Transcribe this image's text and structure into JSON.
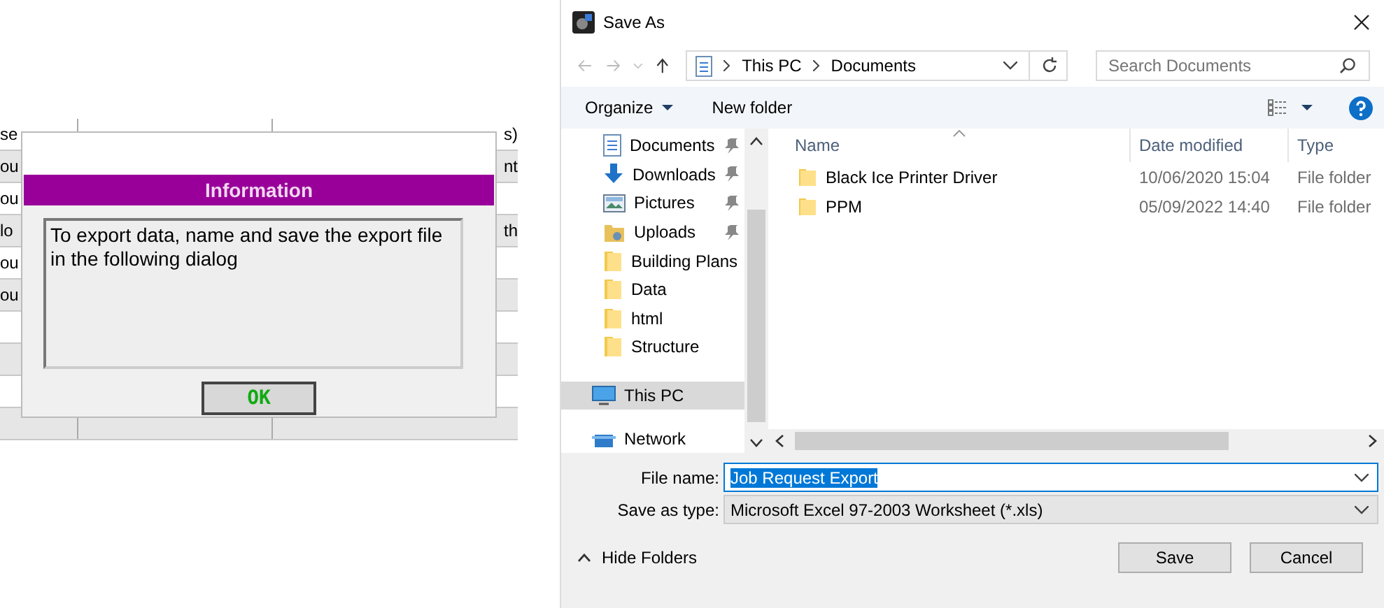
{
  "background_table": {
    "rows": [
      {
        "column_1": "se",
        "column_3": "s)"
      },
      {
        "column_1": "ou",
        "column_3": "nt"
      },
      {
        "column_1": "ou"
      },
      {
        "column_1": "lo",
        "column_3": "th"
      },
      {
        "column_1": "ou"
      },
      {
        "column_1": "ou"
      },
      {},
      {},
      {},
      {}
    ]
  },
  "info_dialog": {
    "title": "Information",
    "message": "To export data, name and save the export file in the following dialog",
    "ok_button": "OK"
  },
  "save_dialog": {
    "title": "Save As",
    "breadcrumb": [
      "This PC",
      "Documents"
    ],
    "search": {
      "placeholder": "Search Documents"
    },
    "toolbar": {
      "organize": "Organize",
      "new_folder": "New folder"
    },
    "nav_items": [
      {
        "label": "Documents",
        "kind": "documents",
        "pinned": true,
        "selected": false
      },
      {
        "label": "Downloads",
        "kind": "downloads",
        "pinned": true,
        "selected": false
      },
      {
        "label": "Pictures",
        "kind": "pictures",
        "pinned": true,
        "selected": false
      },
      {
        "label": "Uploads",
        "kind": "uploads",
        "pinned": true,
        "selected": false
      },
      {
        "label": "Building Plans",
        "kind": "folder",
        "pinned": false,
        "selected": false
      },
      {
        "label": "Data",
        "kind": "folder",
        "pinned": false,
        "selected": false
      },
      {
        "label": "html",
        "kind": "folder",
        "pinned": false,
        "selected": false
      },
      {
        "label": "Structure",
        "kind": "folder",
        "pinned": false,
        "selected": false
      },
      {
        "label": "This PC",
        "kind": "pc",
        "pinned": false,
        "selected": true
      },
      {
        "label": "Network",
        "kind": "network",
        "pinned": false,
        "selected": false
      }
    ],
    "columns": [
      "Name",
      "Date modified",
      "Type"
    ],
    "files": [
      {
        "name": "Black Ice Printer Driver",
        "date": "10/06/2020 15:04",
        "type": "File folder"
      },
      {
        "name": "PPM",
        "date": "05/09/2022 14:40",
        "type": "File folder"
      }
    ],
    "file_name": {
      "label": "File name:",
      "value": "Job Request Export",
      "text_selected": true
    },
    "save_as_type": {
      "label": "Save as type:",
      "value": "Microsoft Excel 97-2003 Worksheet (*.xls)"
    },
    "hide_folders": "Hide Folders",
    "buttons": [
      "Save",
      "Cancel"
    ]
  }
}
